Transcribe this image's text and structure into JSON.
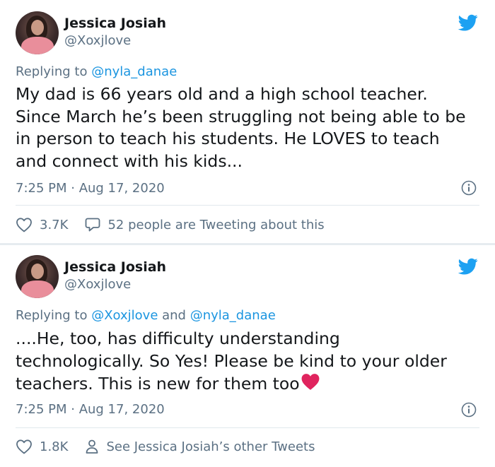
{
  "tweets": [
    {
      "author_name": "Jessica Josiah",
      "handle": "@Xoxjlove",
      "reply_prefix": "Replying to ",
      "reply_mentions": [
        "@nyla_danae"
      ],
      "reply_joiner": "",
      "text_lines": [
        "My dad is 66 years old and a high school teacher.",
        "Since March he’s been struggling not being able to be",
        "in person to teach his students. He LOVES to teach",
        "and connect with his kids..."
      ],
      "timestamp": "7:25 PM · Aug 17, 2020",
      "likes": "3.7K",
      "secondary_action": "52 people are Tweeting about this",
      "secondary_icon": "speech-bubble-icon"
    },
    {
      "author_name": "Jessica Josiah",
      "handle": "@Xoxjlove",
      "reply_prefix": "Replying to ",
      "reply_mentions": [
        "@Xoxjlove",
        "@nyla_danae"
      ],
      "reply_joiner": " and ",
      "text_lines": [
        "....He, too, has difficulty understanding",
        "technologically. So Yes! Please be kind to your older",
        "teachers. This is new for them too"
      ],
      "timestamp": "7:25 PM · Aug 17, 2020",
      "likes": "1.8K",
      "secondary_action": "See Jessica Josiah’s other Tweets",
      "secondary_icon": "person-icon"
    }
  ],
  "colors": {
    "text": "#14171a",
    "muted": "#5b7083",
    "link": "#1b95e0",
    "twitter_blue": "#1da1f2",
    "heart_emoji": "#e0245e"
  }
}
